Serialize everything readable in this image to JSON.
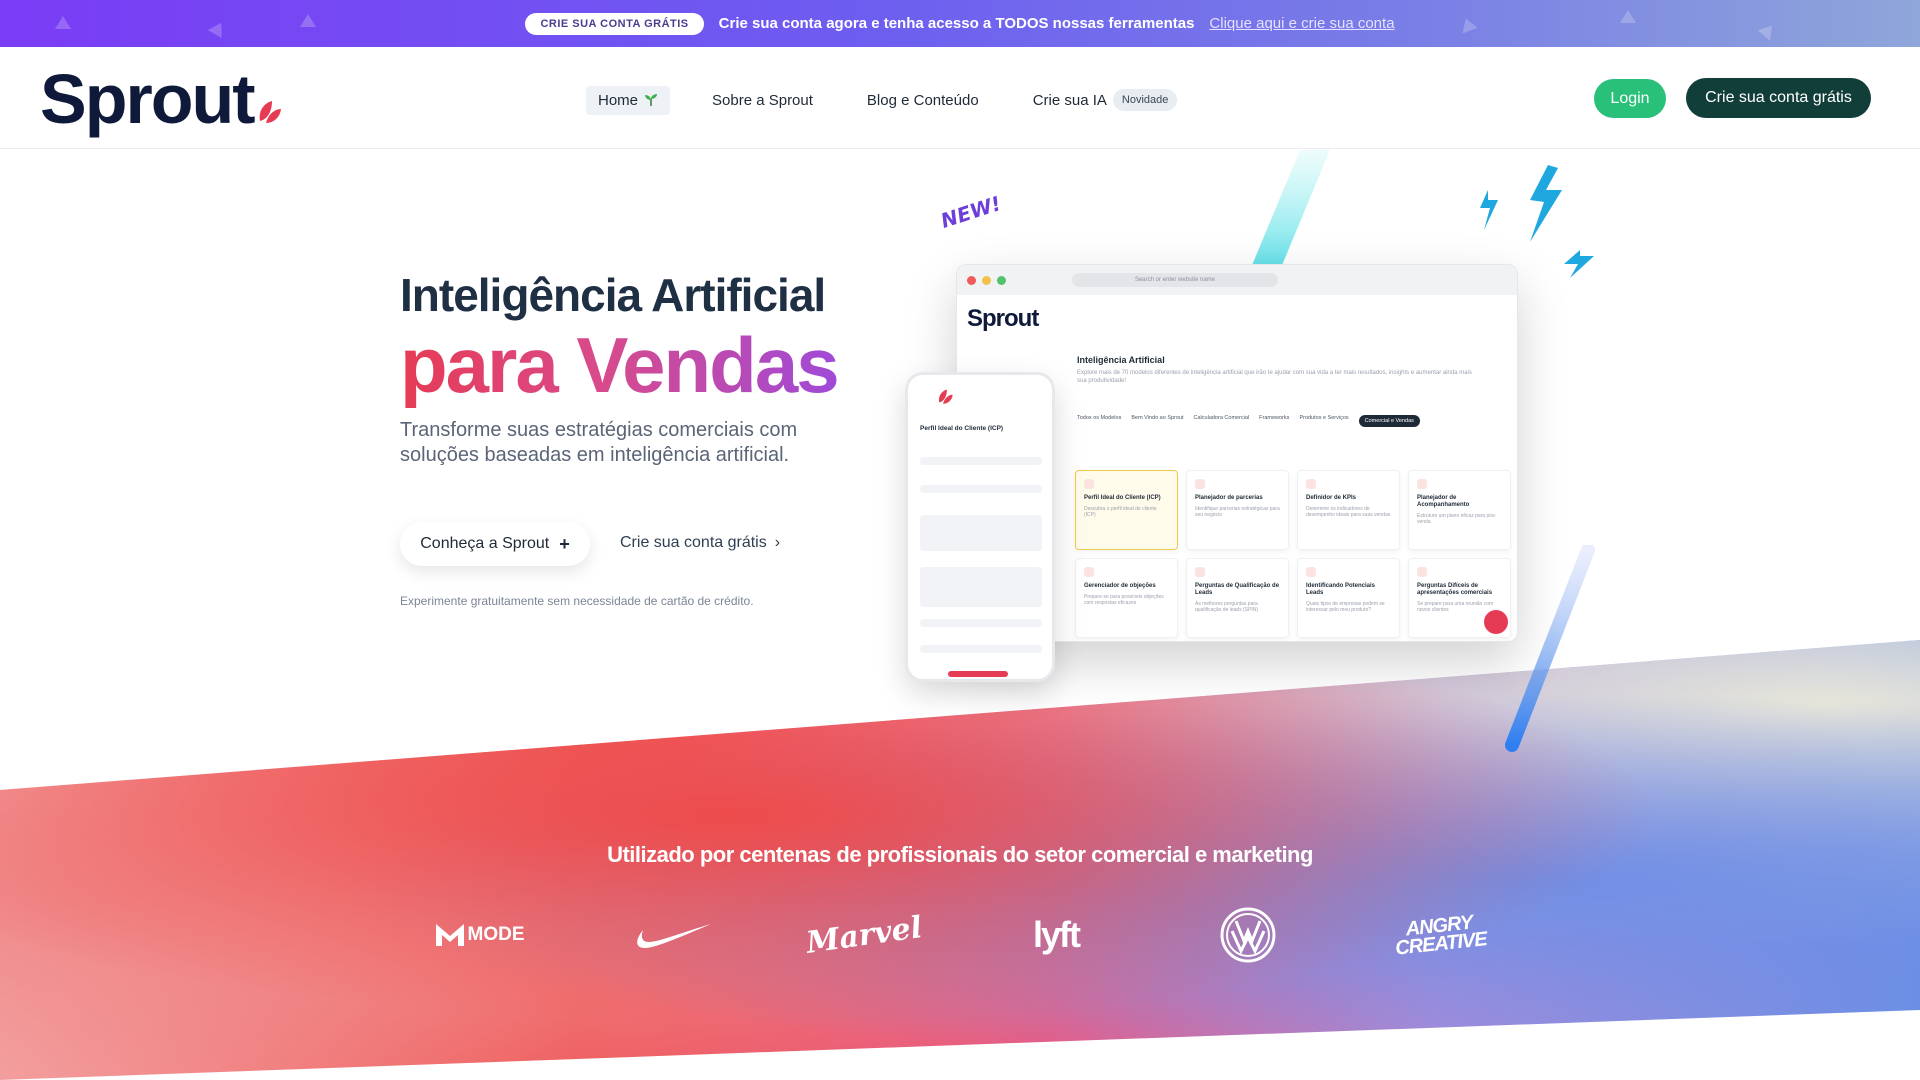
{
  "banner": {
    "pill": "CRIE SUA CONTA GRÁTIS",
    "text": "Crie sua conta agora e tenha acesso a TODOS nossas ferramentas",
    "link": "Clique aqui e crie sua conta"
  },
  "header": {
    "logo": "Sprout",
    "nav": [
      {
        "label": "Home",
        "icon": "sprout-icon"
      },
      {
        "label": "Sobre a Sprout"
      },
      {
        "label": "Blog e Conteúdo"
      },
      {
        "label": "Crie sua IA",
        "badge": "Novidade"
      }
    ],
    "login": "Login",
    "create": "Crie sua conta grátis"
  },
  "hero": {
    "title_line1": "Inteligência Artificial",
    "title_line2": "para Vendas",
    "description": "Transforme suas estratégias comerciais com soluções baseadas em inteligência artificial.",
    "primary_button": "Conheça a Sprout",
    "secondary_link": "Crie sua conta grátis",
    "note": "Experimente gratuitamente sem necessidade de cartão de crédito."
  },
  "mockup": {
    "new_tag": "NEW!",
    "url": "Search or enter website name",
    "app_logo": "Sprout",
    "section_title": "Inteligência Artificial",
    "section_sub": "Explore mais de 70 modelos diferentes de inteligência artificial que irão te ajudar com sua vida a ter mais resultados, insights e aumentar ainda mais sua produtividade!",
    "tabs": [
      "Todos os Modelos",
      "Bem Vindo ao Sprout",
      "Calculadora Comercial",
      "Frameworks",
      "Produtos e Serviços",
      "Comercial e Vendas"
    ],
    "cards": [
      {
        "title": "Perfil Ideal do Cliente (ICP)",
        "desc": "Descubra o perfil ideal de cliente (ICP)"
      },
      {
        "title": "Planejador de parcerias",
        "desc": "Identifique parcerias estratégicas para seu negócio"
      },
      {
        "title": "Definidor de KPIs",
        "desc": "Determine os indicadores de desempenho ideais para suas vendas"
      },
      {
        "title": "Planejador de Acompanhamento",
        "desc": "Estruture um plano eficaz para pós-venda"
      },
      {
        "title": "Gerenciador de objeções",
        "desc": "Prepare-se para possíveis objeções com respostas eficazes"
      },
      {
        "title": "Perguntas de Qualificação de Leads",
        "desc": "As melhores perguntas para qualificação de leads (SPIN)"
      },
      {
        "title": "Identificando Potenciais Leads",
        "desc": "Quais tipos de empresas podem se interessar pelo meu produto?"
      },
      {
        "title": "Perguntas Difíceis de apresentações comerciais",
        "desc": "Se prepare para uma reunião com novos clientes"
      }
    ],
    "phone_title": "Perfil Ideal do Cliente (ICP)"
  },
  "social_proof": {
    "title": "Utilizado por centenas de profissionais do setor comercial e marketing",
    "brands": [
      {
        "name": "MODE",
        "icon": "mode-logo"
      },
      {
        "name": "Nike",
        "icon": "nike-swoosh-logo"
      },
      {
        "name": "Marvel",
        "icon": "marvel-logo"
      },
      {
        "name": "lyft",
        "icon": "lyft-logo"
      },
      {
        "name": "Volkswagen",
        "icon": "vw-logo"
      },
      {
        "name": "ANGRY CREATIVE",
        "icon": "angry-creative-logo"
      }
    ]
  },
  "colors": {
    "brand_dark": "#123e3a",
    "brand_green": "#29c07a",
    "accent_red": "#e63b55",
    "accent_purple": "#9f4ad8",
    "banner_purple": "#7a3cf5"
  }
}
